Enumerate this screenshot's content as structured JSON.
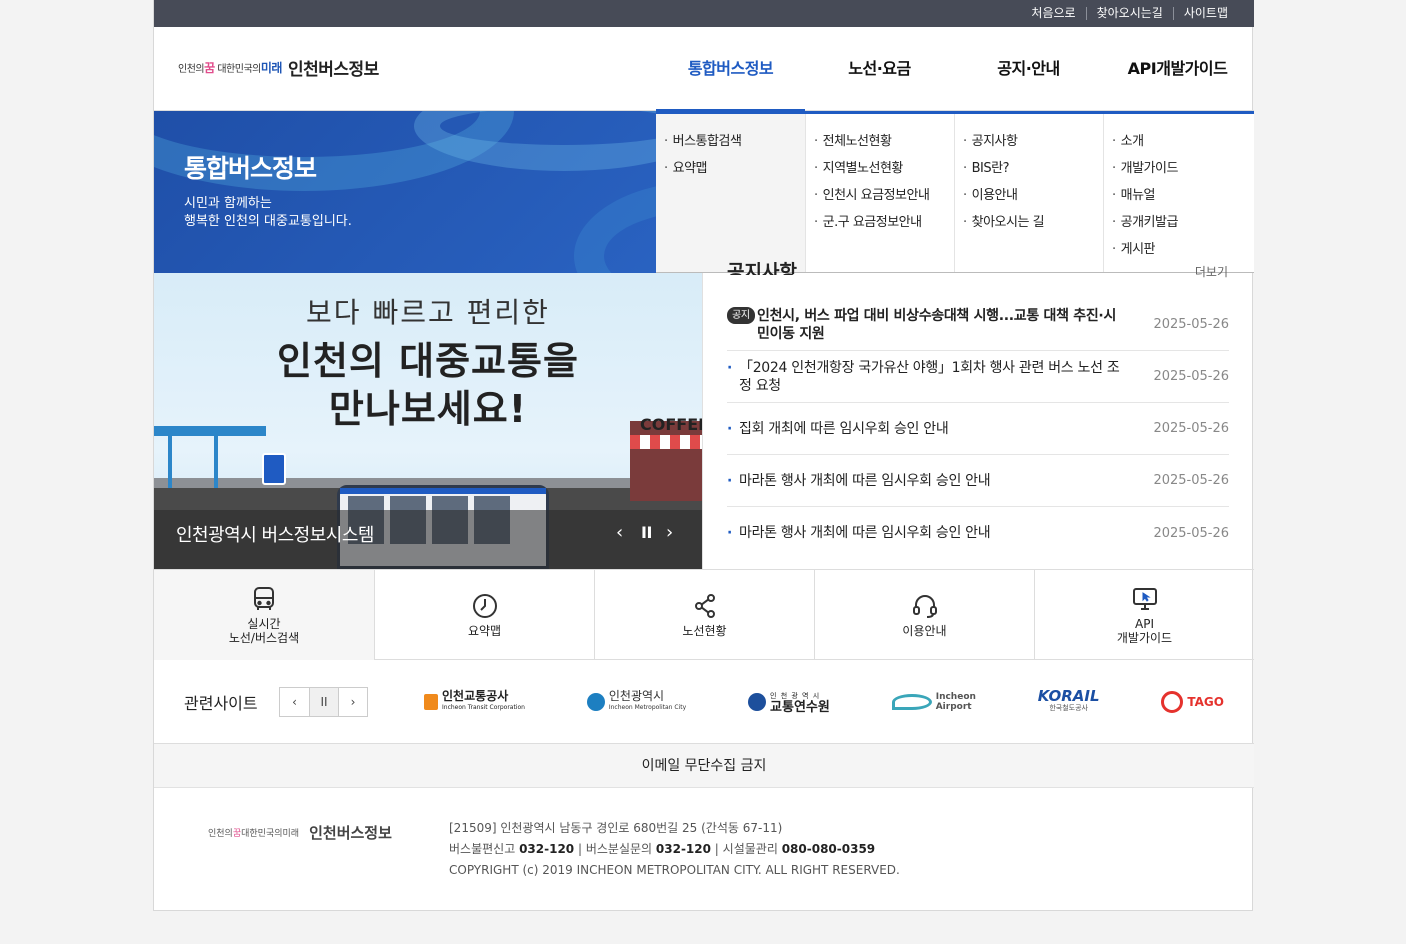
{
  "util_links": [
    "처음으로",
    "찾아오시는길",
    "사이트맵"
  ],
  "logo": {
    "slogan_prefix": "인천의",
    "slogan_dream": "꿈",
    "slogan_mid": "대한민국의",
    "slogan_mirae": "미래",
    "title": "인천버스정보"
  },
  "gnb": [
    "통합버스정보",
    "노선·요금",
    "공지·안내",
    "API개발가이드"
  ],
  "hero": {
    "title": "통합버스정보",
    "sub1": "시민과 함께하는",
    "sub2": "행복한 인천의 대중교통입니다."
  },
  "mega": [
    [
      "버스통합검색",
      "요약맵"
    ],
    [
      "전체노선현황",
      "지역별노선현황",
      "인천시 요금정보안내",
      "군.구 요금정보안내"
    ],
    [
      "공지사항",
      "BIS란?",
      "이용안내",
      "찾아오시는 길"
    ],
    [
      "소개",
      "개발가이드",
      "매뉴얼",
      "공개키발급",
      "게시판"
    ]
  ],
  "slider": {
    "line1": "보다 빠르고 편리한",
    "line2": "인천의 대중교통을",
    "line3": "만나보세요!",
    "caption": "인천광역시 버스정보시스템",
    "cafe": "COFFEE"
  },
  "notice": {
    "title": "공지사항",
    "more": "더보기",
    "badge": "공지",
    "items": [
      {
        "text": "인천시, 버스 파업 대비 비상수송대책 시행...교통 대책 추진·시민이동 지원",
        "date": "2025-05-26"
      },
      {
        "text": "「2024 인천개항장 국가유산 야행」1회차 행사 관련 버스 노선 조정 요청",
        "date": "2025-05-26"
      },
      {
        "text": "집회 개최에 따른 임시우회 승인 안내",
        "date": "2025-05-26"
      },
      {
        "text": "마라톤 행사 개최에 따른 임시우회 승인 안내",
        "date": "2025-05-26"
      },
      {
        "text": "마라톤 행사 개최에 따른 임시우회 승인 안내",
        "date": "2025-05-26"
      }
    ]
  },
  "quick": [
    {
      "label": "실시간\n노선/버스검색",
      "icon": "bus-icon"
    },
    {
      "label": "요약맵",
      "icon": "clock-icon"
    },
    {
      "label": "노선현황",
      "icon": "share-icon"
    },
    {
      "label": "이용안내",
      "icon": "headset-icon"
    },
    {
      "label": "API\n개발가이드",
      "icon": "monitor-cursor-icon"
    }
  ],
  "related": {
    "title": "관련사이트",
    "sites": [
      {
        "name": "인천교통공사",
        "sub": "Incheon Transit Corporation",
        "color": "#f08a1c"
      },
      {
        "name": "인천광역시",
        "sub": "Incheon Metropolitan City",
        "color": "#1d7fc1"
      },
      {
        "name": "교통연수원",
        "sub": "인 천 광 역 시",
        "color": "#1d4f9c"
      },
      {
        "name": "Incheon",
        "sub": "Airport",
        "color": "#3aa6b9"
      },
      {
        "name": "KORAIL",
        "sub": "한국철도공사",
        "color": "#1b4fa3"
      },
      {
        "name": "TAGO",
        "sub": "",
        "color": "#e5322d"
      }
    ]
  },
  "email_notice": "이메일 무단수집 금지",
  "footer": {
    "title": "인천버스정보",
    "address": "[21509] 인천광역시 남동구 경인로 680번길 25 (간석동 67-11)",
    "tel1_label": "버스불편신고",
    "tel1": "032-120",
    "tel2_label": "버스분실문의",
    "tel2": "032-120",
    "tel3_label": "시설물관리",
    "tel3": "080-080-0359",
    "copyright": "COPYRIGHT (c) 2019 INCHEON METROPOLITAN CITY. ALL RIGHT RESERVED."
  },
  "colors": {
    "accent": "#1f5bc2",
    "util_bar": "#474b57"
  }
}
